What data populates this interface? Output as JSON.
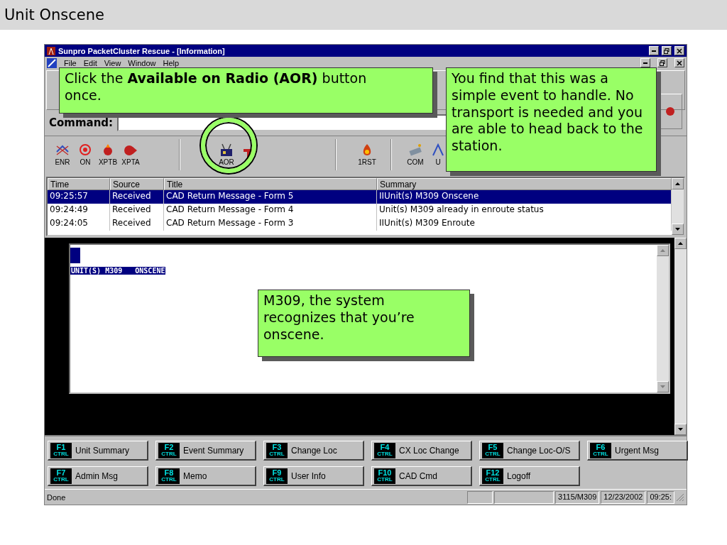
{
  "slide": {
    "title": "Unit Onscene"
  },
  "window": {
    "title": "Sunpro PacketCluster Rescue - [Information]"
  },
  "menu": [
    "File",
    "Edit",
    "View",
    "Window",
    "Help"
  ],
  "command": {
    "label": "Command:"
  },
  "toolbar": [
    {
      "buttons": [
        {
          "label": "ENR"
        },
        {
          "label": "ON"
        },
        {
          "label": "XPTB"
        },
        {
          "label": "XPTA"
        }
      ]
    },
    {
      "buttons": [
        {
          "label": "AOR"
        },
        {
          "kind": "unlabelled"
        }
      ]
    },
    {
      "buttons": [
        {
          "label": "1RST"
        }
      ]
    },
    {
      "buttons": [
        {
          "label": "COM"
        },
        {
          "label": "U"
        }
      ]
    }
  ],
  "list": {
    "columns": [
      "Time",
      "Source",
      "Title",
      "Summary"
    ],
    "rows": [
      {
        "selected": true,
        "cells": [
          "09:25:57",
          "Received",
          "CAD Return Message - Form 5",
          "IIUnit(s) M309  Onscene"
        ]
      },
      {
        "selected": false,
        "cells": [
          "09:24:49",
          "Received",
          "CAD Return Message - Form 4",
          "Unit(s) M309 already in enroute status"
        ]
      },
      {
        "selected": false,
        "cells": [
          "09:24:05",
          "Received",
          "CAD Return Message - Form 3",
          "IIUnit(s) M309  Enroute"
        ]
      }
    ]
  },
  "document": {
    "text": "UNIT(S) M309   ONSCENE"
  },
  "function_keys": [
    {
      "key": "F1",
      "modifier": "CTRL",
      "label": "Unit Summary"
    },
    {
      "key": "F2",
      "modifier": "CTRL",
      "label": "Event Summary"
    },
    {
      "key": "F3",
      "modifier": "CTRL",
      "label": "Change Loc"
    },
    {
      "key": "F4",
      "modifier": "CTRL",
      "label": "CX Loc Change"
    },
    {
      "key": "F5",
      "modifier": "CTRL",
      "label": "Change Loc-O/S"
    },
    {
      "key": "F6",
      "modifier": "CTRL",
      "label": "Urgent Msg"
    },
    {
      "key": "F7",
      "modifier": "CTRL",
      "label": "Admin Msg"
    },
    {
      "key": "F8",
      "modifier": "CTRL",
      "label": "Memo"
    },
    {
      "key": "F9",
      "modifier": "CTRL",
      "label": "User Info"
    },
    {
      "key": "F10",
      "modifier": "CTRL",
      "label": "CAD Cmd"
    },
    {
      "key": "F12",
      "modifier": "CTRL",
      "label": "Logoff"
    }
  ],
  "status_bar": {
    "message": "Done",
    "panels": [
      "3115/M309",
      "12/23/2002",
      "09:25:"
    ]
  },
  "callouts": [
    {
      "text": "Click the **Available on Radio (AOR)** button once."
    },
    {
      "text": "You find that this was a simple event to handle. No transport is needed and you are able to head back to the station."
    },
    {
      "text": "M309, the system recognizes that you’re onscene."
    }
  ]
}
